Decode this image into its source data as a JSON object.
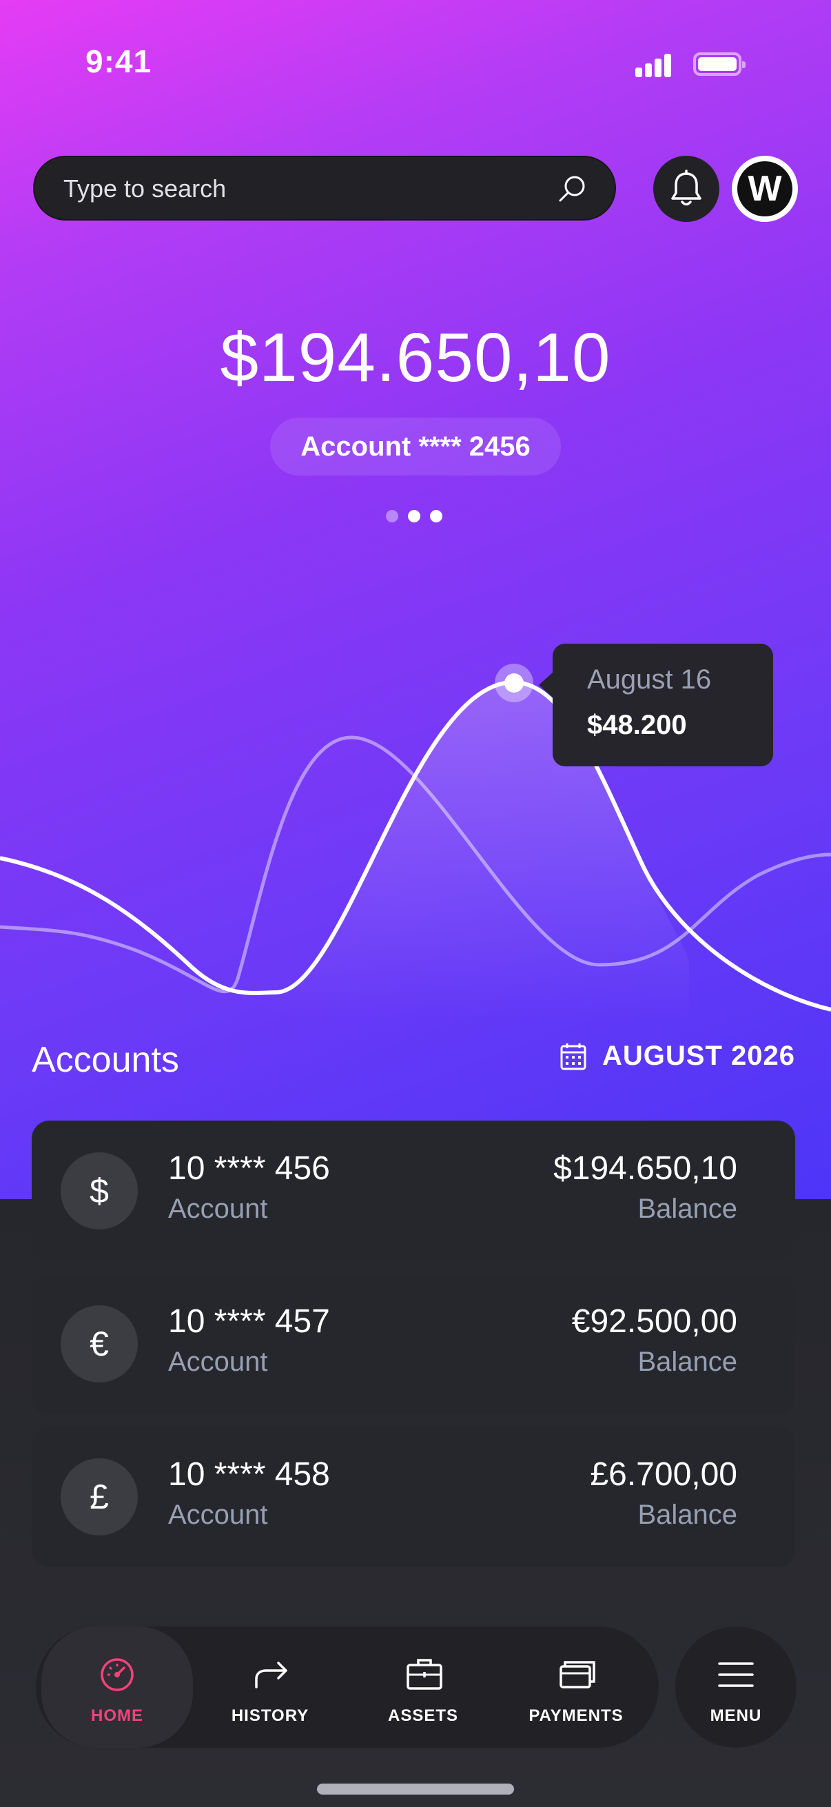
{
  "status_bar": {
    "time": "9:41"
  },
  "search": {
    "placeholder": "Type to search"
  },
  "profile": {
    "avatar_initial": "W"
  },
  "hero": {
    "balance": "$194.650,10",
    "account_label": "Account **** 2456",
    "carousel": {
      "pages": 3,
      "active_index": 2
    }
  },
  "chart_data": {
    "type": "line",
    "tooltip": {
      "date": "August 16",
      "value": "$48.200"
    },
    "series": [
      {
        "values": [
          0.3,
          0.2,
          0.05,
          0.05,
          0.63,
          0.3,
          0.2,
          0.35
        ]
      },
      {
        "values": [
          0.4,
          0.4,
          0.05,
          0.55,
          0.45,
          0.1,
          0.1,
          0.45
        ]
      }
    ]
  },
  "accounts": {
    "title": "Accounts",
    "period": "AUGUST 2026",
    "items": [
      {
        "currency_symbol": "$",
        "number": "10 **** 456",
        "label": "Account",
        "amount": "$194.650,10",
        "amount_label": "Balance"
      },
      {
        "currency_symbol": "€",
        "number": "10 **** 457",
        "label": "Account",
        "amount": "€92.500,00",
        "amount_label": "Balance"
      },
      {
        "currency_symbol": "£",
        "number": "10 **** 458",
        "label": "Account",
        "amount": "£6.700,00",
        "amount_label": "Balance"
      }
    ]
  },
  "nav": {
    "items": [
      {
        "label": "HOME",
        "icon": "speedometer-icon",
        "active": true
      },
      {
        "label": "HISTORY",
        "icon": "forward-arrow-icon",
        "active": false
      },
      {
        "label": "ASSETS",
        "icon": "briefcase-icon",
        "active": false
      },
      {
        "label": "PAYMENTS",
        "icon": "cards-icon",
        "active": false
      }
    ],
    "menu_label": "MENU"
  },
  "colors": {
    "accent_active": "#f0447a",
    "card_bg": "#26272c"
  }
}
